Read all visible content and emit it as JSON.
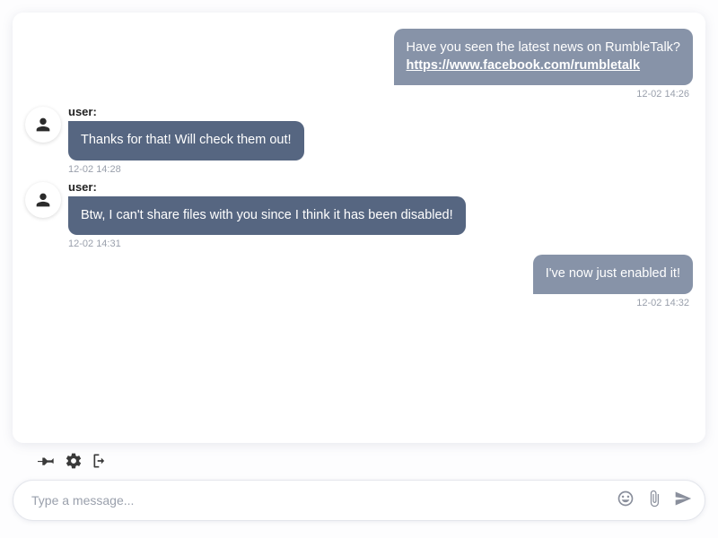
{
  "messages": [
    {
      "side": "right",
      "text": "Have you seen the latest news on RumbleTalk?",
      "link": "https://www.facebook.com/rumbletalk",
      "timestamp": "12-02 14:26"
    },
    {
      "side": "left",
      "user": "user:",
      "text": "Thanks for that! Will check them out!",
      "timestamp": "12-02 14:28"
    },
    {
      "side": "left",
      "user": "user:",
      "text": "Btw, I can't share files with you since I think it has been disabled!",
      "timestamp": "12-02 14:31"
    },
    {
      "side": "right",
      "text": "I've now just enabled it!",
      "timestamp": "12-02 14:32"
    }
  ],
  "input": {
    "placeholder": "Type a message..."
  }
}
